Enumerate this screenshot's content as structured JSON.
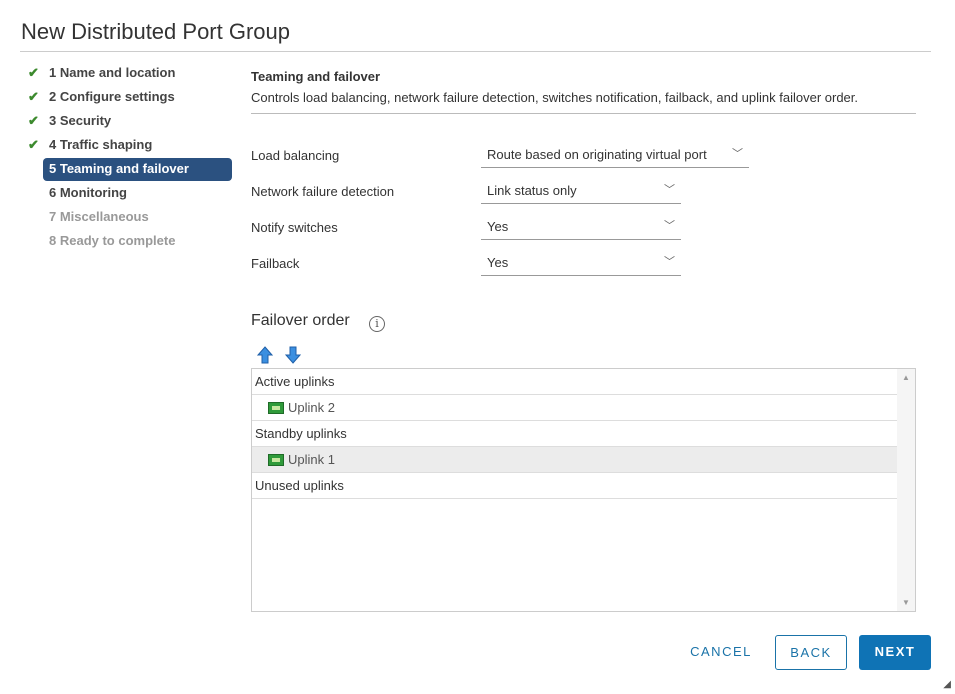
{
  "title": "New Distributed Port Group",
  "nav": [
    {
      "label": "1 Name and location",
      "state": "done"
    },
    {
      "label": "2 Configure settings",
      "state": "done"
    },
    {
      "label": "3 Security",
      "state": "done"
    },
    {
      "label": "4 Traffic shaping",
      "state": "done"
    },
    {
      "label": "5 Teaming and failover",
      "state": "active"
    },
    {
      "label": "6 Monitoring",
      "state": "enabled"
    },
    {
      "label": "7 Miscellaneous",
      "state": "disabled"
    },
    {
      "label": "8 Ready to complete",
      "state": "disabled"
    }
  ],
  "section": {
    "heading": "Teaming and failover",
    "description": "Controls load balancing, network failure detection, switches notification, failback, and uplink failover order."
  },
  "form": [
    {
      "label": "Load balancing",
      "value": "Route based on originating virtual port"
    },
    {
      "label": "Network failure detection",
      "value": "Link status only"
    },
    {
      "label": "Notify switches",
      "value": "Yes"
    },
    {
      "label": "Failback",
      "value": "Yes"
    }
  ],
  "failover": {
    "title": "Failover order",
    "groups": {
      "active": "Active uplinks",
      "standby": "Standby uplinks",
      "unused": "Unused uplinks"
    },
    "items": {
      "active0": "Uplink 2",
      "standby0": "Uplink 1"
    }
  },
  "buttons": {
    "cancel": "CANCEL",
    "back": "BACK",
    "next": "NEXT"
  },
  "colors": {
    "accent": "#0f73b5",
    "nav_active": "#2b5180",
    "check": "#3c8a2e"
  }
}
